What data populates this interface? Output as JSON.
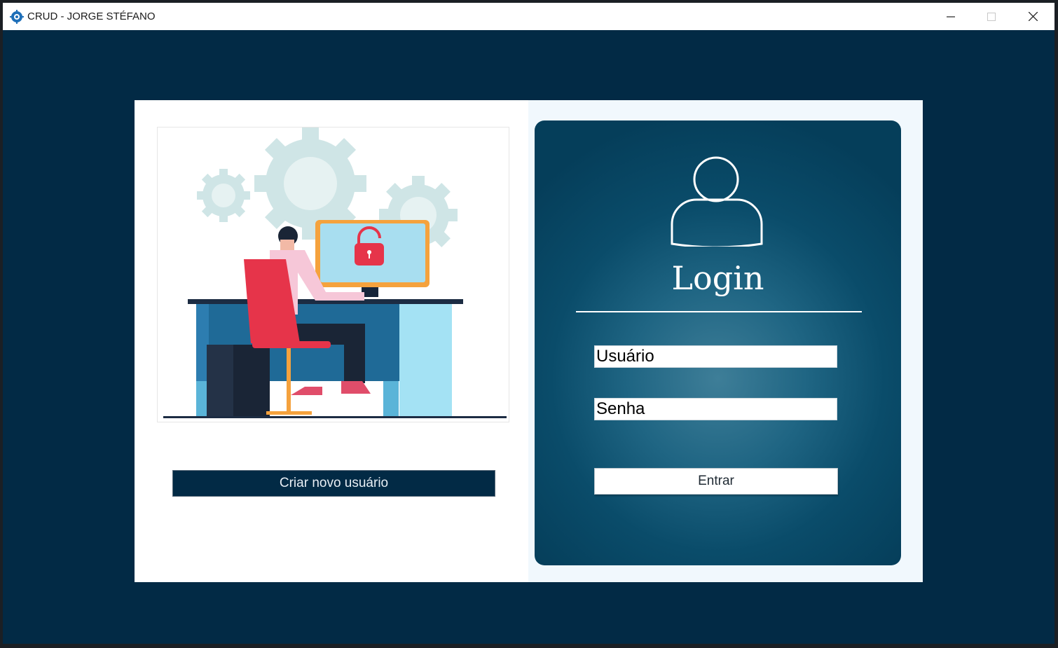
{
  "window": {
    "title": "CRUD - JORGE STÉFANO",
    "app_icon": "gear-globe-icon",
    "controls": [
      "minimize-icon",
      "maximize-icon",
      "close-icon"
    ]
  },
  "left": {
    "illustration": "person-at-computer-with-lock-illustration",
    "create_button_label": "Criar novo usuário"
  },
  "login": {
    "icon": "user-icon",
    "title": "Login",
    "username_value": "Usuário",
    "password_value": "Senha",
    "submit_label": "Entrar"
  },
  "colors": {
    "background": "#022a45",
    "panel_dark": "#053e5a",
    "panel_glow": "#3e7e98",
    "card": "#ffffff"
  }
}
